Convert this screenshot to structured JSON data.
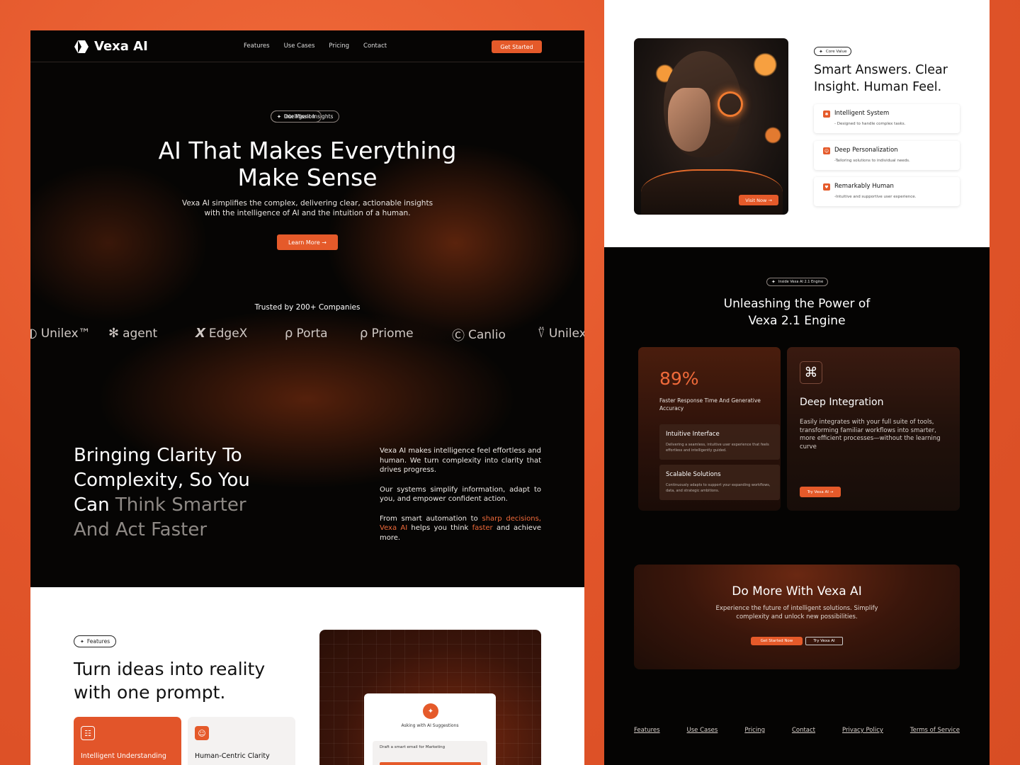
{
  "colors": {
    "accent": "#e55a2a",
    "background": "#e85a2c",
    "dark": "#060504"
  },
  "nav": {
    "brand": "Vexa AI",
    "links": [
      "Features",
      "Use Cases",
      "Pricing",
      "Contact"
    ],
    "cta": "Get Started"
  },
  "hero": {
    "badge": "Intelligent Insights",
    "title_line1": "AI That Makes Everything",
    "title_line2": "Make Sense",
    "subtitle_line1": "Vexa AI simplifies the complex, delivering clear, actionable insights",
    "subtitle_line2": "with the intelligence of AI and the intuition of a human.",
    "button": "Learn More →",
    "trusted": "Trusted by 200+ Companies",
    "logos": [
      {
        "icon": "circle-half-icon",
        "name": "Unilex™"
      },
      {
        "icon": "asterisk-icon",
        "name": "agent"
      },
      {
        "icon": "x-icon",
        "name": "EdgeX"
      },
      {
        "icon": "p-pin-icon",
        "name": "Porta"
      },
      {
        "icon": "p-pin-icon",
        "name": "Priome"
      },
      {
        "icon": "c-circle-icon",
        "name": "Canlio"
      },
      {
        "icon": "bowl-icon",
        "name": "Unilex"
      }
    ]
  },
  "mission": {
    "badge": "Our Mission",
    "heading_a": "Bringing Clarity To Complexity, So You Can ",
    "heading_b": "Think Smarter And Act Faster",
    "p1": "Vexa AI makes intelligence feel effortless and human. We turn complexity into clarity that drives progress.",
    "p2": "Our systems simplify information, adapt to you, and empower confident action.",
    "p3_a": "From smart automation to ",
    "p3_b": "sharp decisions,",
    "p3_c": " ",
    "p3_d": "Vexa AI",
    "p3_e": " helps you think ",
    "p3_f": "faster",
    "p3_g": " and achieve more."
  },
  "features": {
    "badge": "Features",
    "heading": "Turn ideas into reality with one prompt.",
    "cards": [
      {
        "icon": "brain-icon",
        "title": "Intelligent Understanding"
      },
      {
        "icon": "user-icon",
        "title": "Human-Centric Clarity"
      }
    ],
    "demo": {
      "asking": "Asking with AI Suggestions",
      "draft": "Draft a smart email for Marketing"
    }
  },
  "core": {
    "visit": "Visit Now →",
    "badge": "Core Value",
    "heading": "Smart Answers. Clear Insight. Human Feel.",
    "values": [
      {
        "title": "Intelligent System",
        "desc": "- Designed to handle complex tasks."
      },
      {
        "title": "Deep Personalization",
        "desc": "-Tailoring solutions to individual needs."
      },
      {
        "title": "Remarkably Human",
        "desc": "-Intuitive and supportive user experience."
      }
    ]
  },
  "engine": {
    "badge": "Inside Vexa AI 2.1 Engine",
    "heading_line1": "Unleashing the Power of",
    "heading_line2": "Vexa 2.1 Engine",
    "stat": "89%",
    "stat_label": "Faster Response Time And Generative Accuracy",
    "subcards": [
      {
        "title": "Intuitive Interface",
        "desc": "Delivering a seamless, intuitive user experience that feels effortless and intelligently guided."
      },
      {
        "title": "Scalable Solutions",
        "desc": "Continuously adapts to support your expanding workflows, data, and strategic ambitions."
      }
    ],
    "integration": {
      "title": "Deep Integration",
      "desc": "Easily integrates with your full suite of tools, transforming familiar workflows into smarter, more efficient processes—without the learning curve",
      "button": "Try Vexa AI →"
    }
  },
  "cta": {
    "title": "Do More With Vexa AI",
    "desc_line1": "Experience the future of intelligent solutions. Simplify",
    "desc_line2": "complexity and unlock new possibilities.",
    "b1": "Get Started Now",
    "b2": "Try Vexa AI"
  },
  "footer": {
    "links": [
      "Features",
      "Use Cases",
      "Pricing",
      "Contact",
      "Privacy Policy",
      "Terms of Service"
    ]
  }
}
